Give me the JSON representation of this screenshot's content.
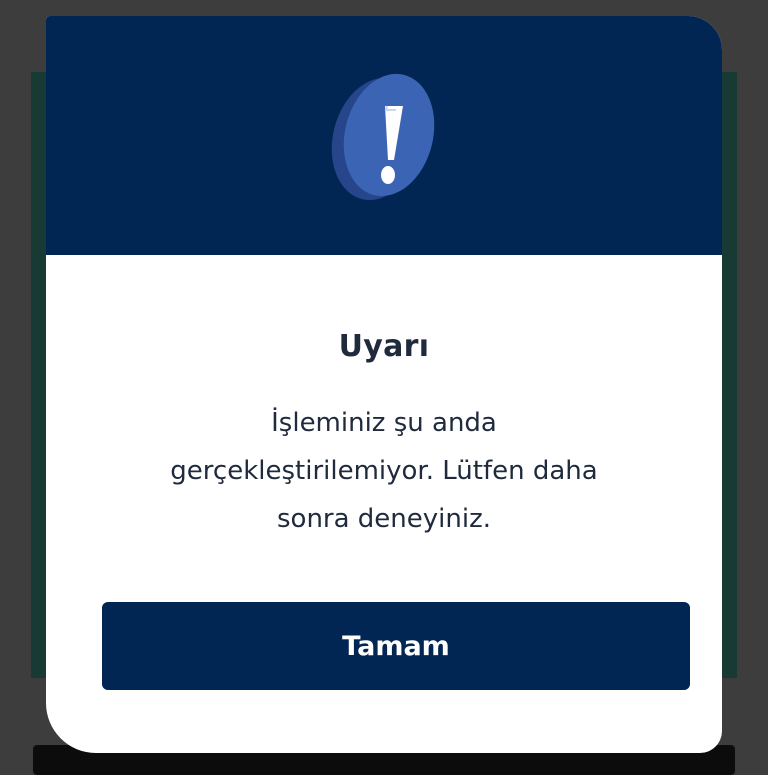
{
  "dialog": {
    "icon": "exclamation-circle-icon",
    "title": "Uyarı",
    "message_lines": [
      "İşleminiz şu anda",
      "gerçekleştirilemiyor. Lütfen daha",
      "sonra deneyiniz."
    ],
    "button_label": "Tamam"
  },
  "colors": {
    "header": "#022654",
    "button": "#022654",
    "icon_face": "#3b64b4",
    "icon_side": "#27458a",
    "text": "#1f2a3d"
  }
}
